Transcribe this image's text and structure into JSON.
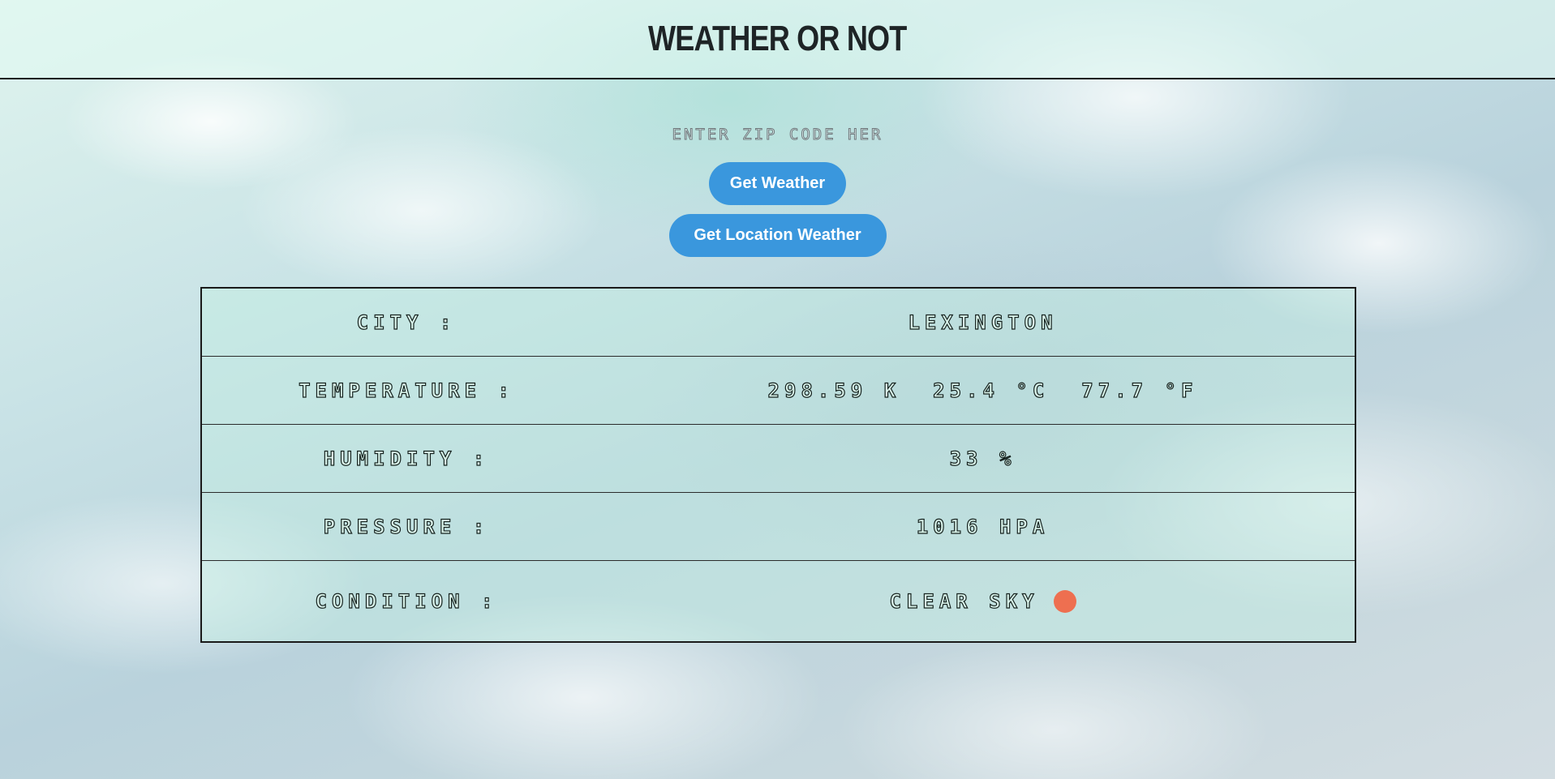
{
  "header": {
    "title": "WEATHER OR NOT"
  },
  "search": {
    "placeholder": "Enter Zip Code Here",
    "value": ""
  },
  "buttons": {
    "get_weather": "Get Weather",
    "get_location_weather": "Get Location Weather"
  },
  "weather": {
    "city": {
      "label": "City :",
      "value": "Lexington"
    },
    "temperature": {
      "label": "Temperature :",
      "kelvin": "298.59 K",
      "celsius": "25.4 °C",
      "fahrenheit": "77.7 °F"
    },
    "humidity": {
      "label": "Humidity :",
      "value": "33 %"
    },
    "pressure": {
      "label": "Pressure :",
      "value": "1016 hPa"
    },
    "condition": {
      "label": "Condition :",
      "value": "clear sky",
      "icon": "sun-icon",
      "icon_color": "#ee6f50"
    }
  },
  "colors": {
    "button_bg": "#3a97dd",
    "button_text": "#ffffff",
    "border": "#1a1a1a"
  }
}
